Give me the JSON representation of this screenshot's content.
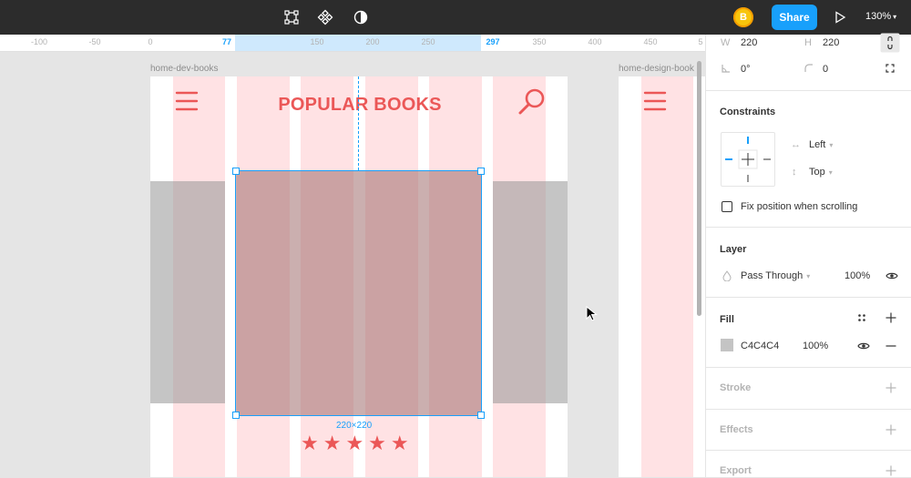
{
  "toolbar": {
    "tool_icons": [
      "frame-tool-icon",
      "component-icon",
      "contrast-icon"
    ],
    "avatar_initial": "B",
    "share_label": "Share",
    "zoom_label": "130%"
  },
  "ruler": {
    "ticks": [
      "-100",
      "-50",
      "0",
      "77",
      "150",
      "200",
      "250",
      "297",
      "350",
      "400",
      "450",
      "5"
    ]
  },
  "canvas": {
    "frame_left_label": "home-dev-books",
    "frame_right_label": "home-design-book",
    "header_title": "POPULAR BOOKS",
    "selection_size": "220×220",
    "stars": "★★★★★",
    "accent": "#eb5757",
    "selection_color": "#18a0fb"
  },
  "panel": {
    "w_label": "W",
    "w_value": "220",
    "h_label": "H",
    "h_value": "220",
    "rotation_value": "0°",
    "radius_value": "0",
    "constraints": {
      "title": "Constraints",
      "horizontal": "Left",
      "vertical": "Top",
      "fix_position_label": "Fix position when scrolling"
    },
    "layer": {
      "title": "Layer",
      "blend_mode": "Pass Through",
      "opacity": "100%"
    },
    "fill": {
      "title": "Fill",
      "hex": "C4C4C4",
      "opacity": "100%",
      "swatch_color": "#c4c4c4"
    },
    "stroke_title": "Stroke",
    "effects_title": "Effects",
    "export_title": "Export"
  }
}
